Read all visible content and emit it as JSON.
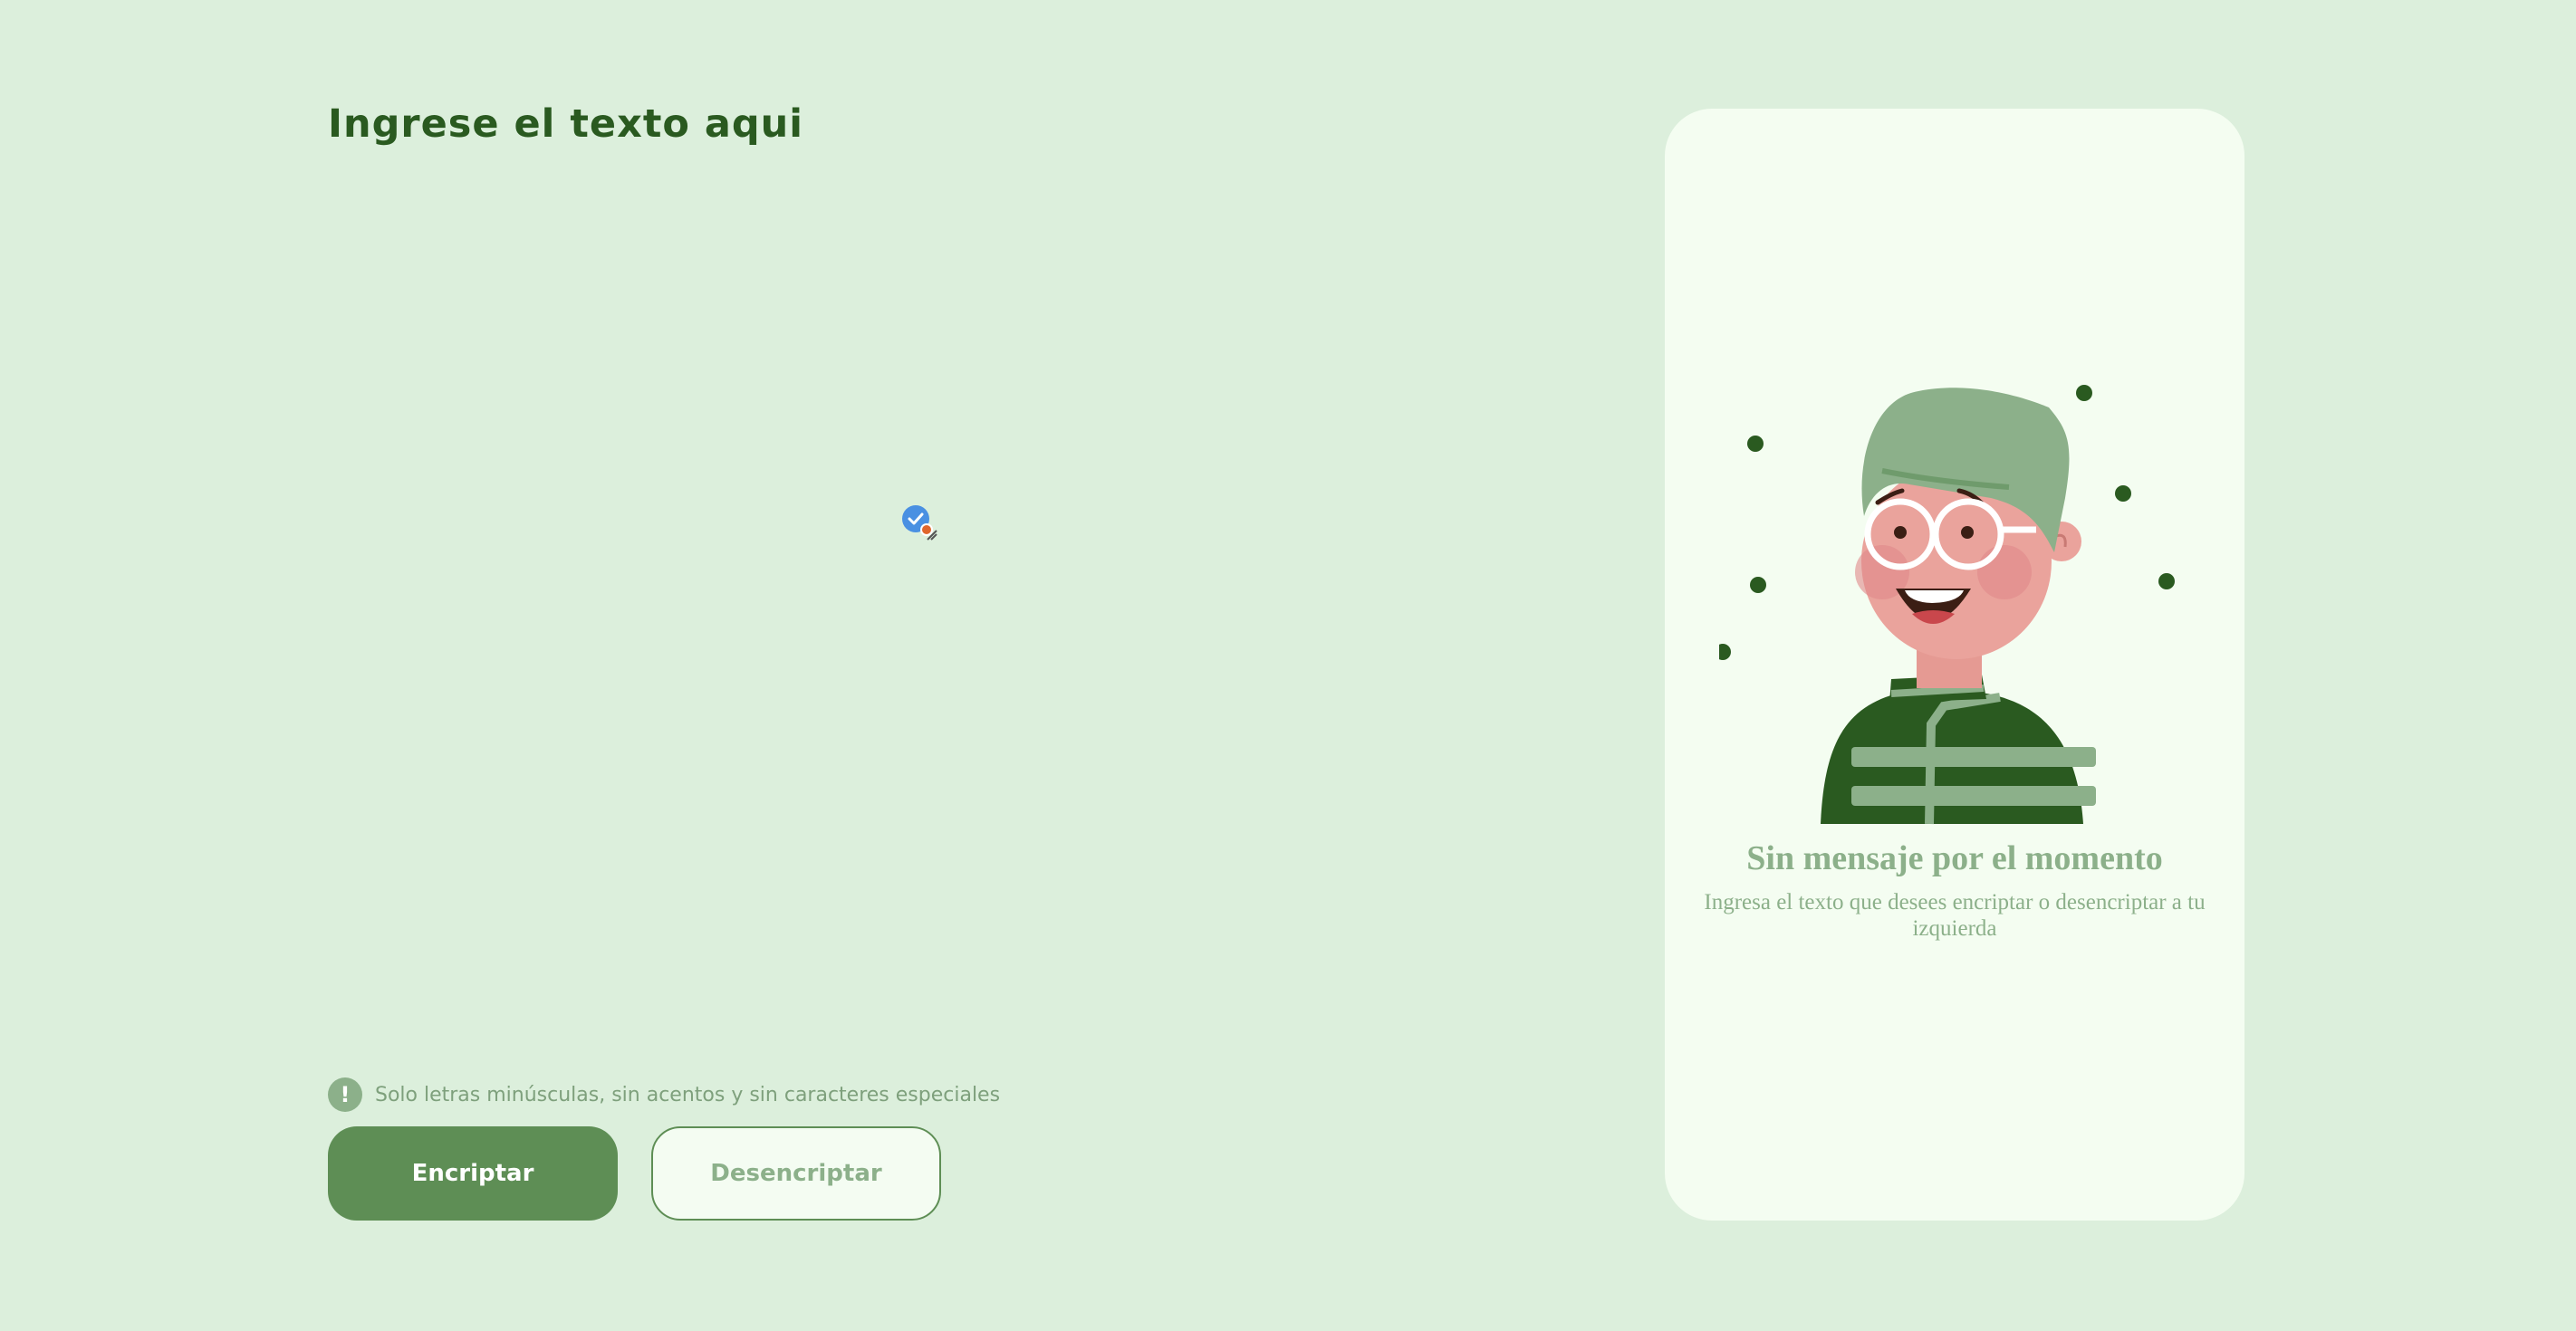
{
  "input": {
    "placeholder": "Ingrese el texto aqui",
    "value": ""
  },
  "hint": {
    "icon": "!",
    "text": "Solo letras minúsculas, sin acentos y sin caracteres especiales"
  },
  "buttons": {
    "encrypt_label": "Encriptar",
    "decrypt_label": "Desencriptar"
  },
  "output": {
    "title": "Sin mensaje por el momento",
    "subtitle": "Ingresa el texto que desees encriptar o desencriptar a tu izquierda"
  },
  "colors": {
    "background": "#dcefdc",
    "accent": "#2a5a20",
    "primary_button": "#5e8e55",
    "muted_text": "#8cb08a",
    "card": "#f4fdf1"
  }
}
